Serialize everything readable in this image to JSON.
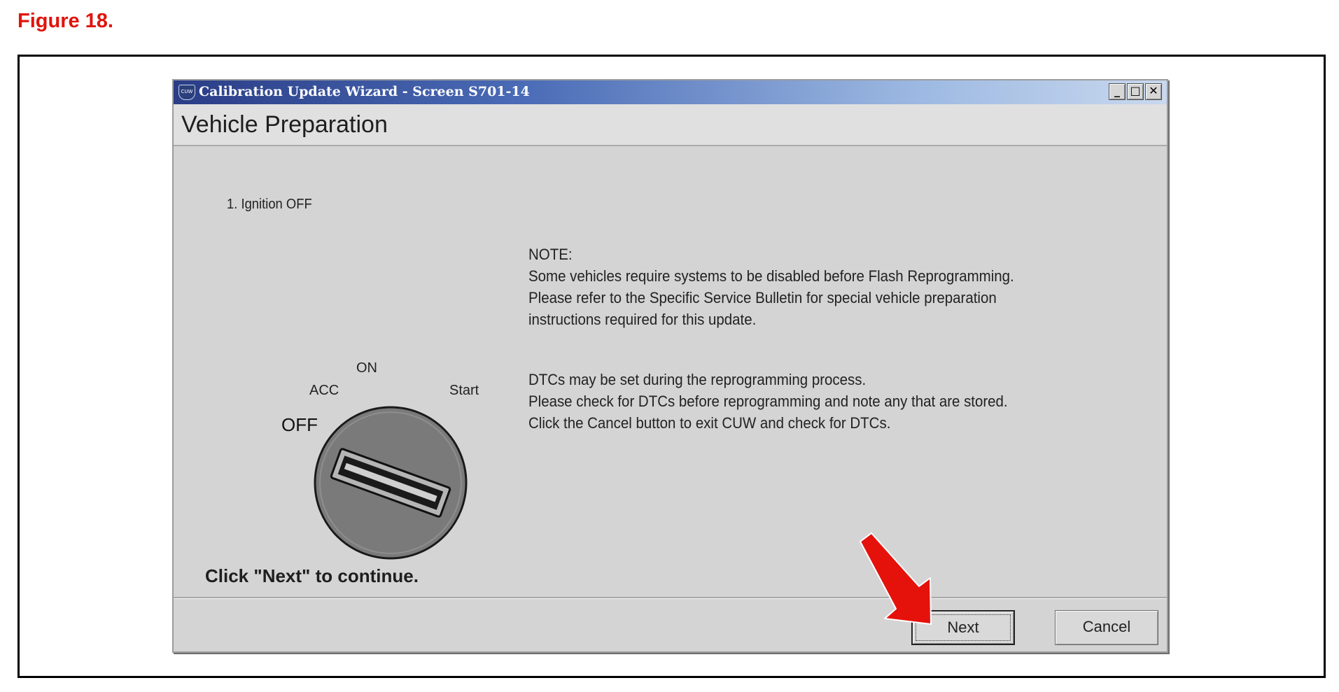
{
  "figure_label": "Figure 18.",
  "window": {
    "title": "Calibration Update Wizard - Screen S701-14",
    "app_icon_text": "CUW",
    "minimize_glyph": "_",
    "maximize_glyph": "□",
    "close_glyph": "✕"
  },
  "header": {
    "title": "Vehicle Preparation"
  },
  "step": {
    "text": "1. Ignition OFF"
  },
  "ignition_labels": {
    "on": "ON",
    "acc": "ACC",
    "start": "Start",
    "off": "OFF"
  },
  "notes": {
    "lines_1": [
      "NOTE:",
      "Some vehicles require systems to be disabled before Flash Reprogramming.",
      "Please refer to the Specific Service Bulletin for special vehicle preparation",
      "instructions required for this update."
    ],
    "lines_2": [
      "DTCs may be set during the reprogramming process.",
      "Please check for DTCs before reprogramming and note any that are stored.",
      "Click the Cancel button to exit CUW and check for DTCs."
    ]
  },
  "footer": {
    "continue_text": "Click \"Next\" to continue.",
    "next_label": "Next",
    "cancel_label": "Cancel"
  },
  "colors": {
    "figure_label": "#e0140c",
    "titlebar_start": "#2a3d86",
    "titlebar_end": "#c9d8ee",
    "window_bg": "#d4d4d4",
    "arrow": "#e5120c",
    "dial": "#7a7a7a"
  },
  "icons": {
    "app": "cuw-shield-icon",
    "minimize": "minimize-icon",
    "maximize": "maximize-icon",
    "close": "close-icon",
    "pointer": "red-arrow-icon"
  }
}
